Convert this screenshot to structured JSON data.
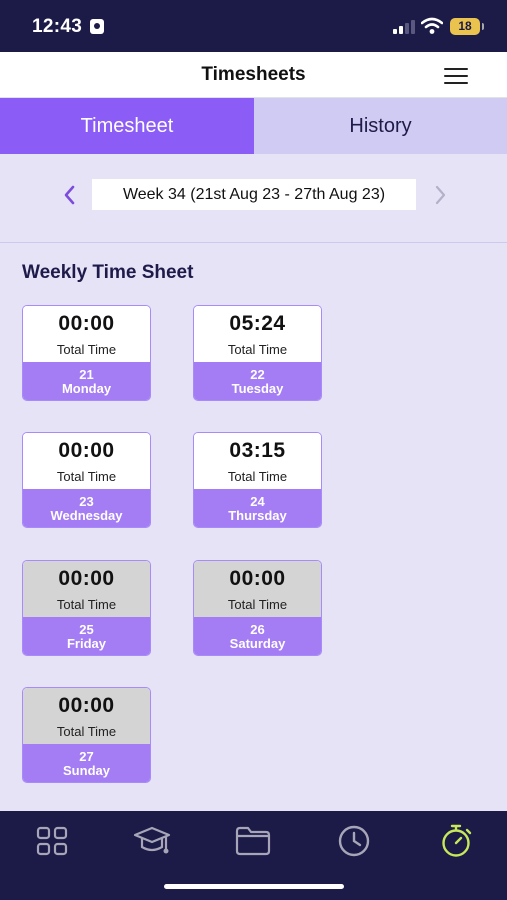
{
  "status_bar": {
    "time": "12:43",
    "battery": "18"
  },
  "header": {
    "title": "Timesheets"
  },
  "tabs": [
    {
      "label": "Timesheet",
      "active": true
    },
    {
      "label": "History",
      "active": false
    }
  ],
  "week": {
    "label": "Week 34 (21st Aug 23 - 27th Aug 23)"
  },
  "section": {
    "title": "Weekly Time Sheet"
  },
  "days": [
    {
      "time": "00:00",
      "total_label": "Total Time",
      "date": "21",
      "day": "Monday",
      "grey": false
    },
    {
      "time": "05:24",
      "total_label": "Total Time",
      "date": "22",
      "day": "Tuesday",
      "grey": false
    },
    {
      "time": "00:00",
      "total_label": "Total Time",
      "date": "23",
      "day": "Wednesday",
      "grey": false
    },
    {
      "time": "03:15",
      "total_label": "Total Time",
      "date": "24",
      "day": "Thursday",
      "grey": false
    },
    {
      "time": "00:00",
      "total_label": "Total Time",
      "date": "25",
      "day": "Friday",
      "grey": true
    },
    {
      "time": "00:00",
      "total_label": "Total Time",
      "date": "26",
      "day": "Saturday",
      "grey": true
    },
    {
      "time": "00:00",
      "total_label": "Total Time",
      "date": "27",
      "day": "Sunday",
      "grey": true
    }
  ],
  "bottom_nav": [
    {
      "icon": "grid-icon",
      "active": false
    },
    {
      "icon": "graduation-cap-icon",
      "active": false
    },
    {
      "icon": "folder-icon",
      "active": false
    },
    {
      "icon": "clock-icon",
      "active": false
    },
    {
      "icon": "stopwatch-icon",
      "active": true
    }
  ],
  "colors": {
    "brand_dark": "#1c1a47",
    "accent": "#8b5cf6",
    "active_nav": "#c6e85a",
    "background": "#e6e3f6"
  }
}
